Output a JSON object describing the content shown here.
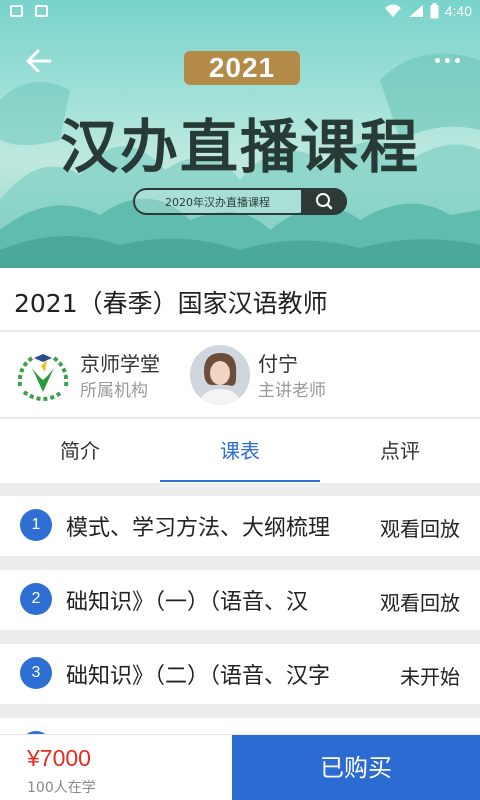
{
  "status_bar": {
    "time": "4:40"
  },
  "banner": {
    "year": "2021",
    "title": "汉办直播课程",
    "search_placeholder": "2020年汉办直播课程"
  },
  "course": {
    "title": "2021（春季）国家汉语教师"
  },
  "institution": {
    "name": "京师学堂",
    "role": "所属机构"
  },
  "teacher": {
    "name": "付宁",
    "role": "主讲老师"
  },
  "tabs": [
    {
      "label": "简介",
      "active": false
    },
    {
      "label": "课表",
      "active": true
    },
    {
      "label": "点评",
      "active": false
    }
  ],
  "lessons": [
    {
      "num": "1",
      "title": "模式、学习方法、大纲梳理",
      "status": "观看回放"
    },
    {
      "num": "2",
      "title": "础知识》（一）（语音、汉",
      "status": "观看回放"
    },
    {
      "num": "3",
      "title": "础知识》（二）（语音、汉字",
      "status": "未开始"
    }
  ],
  "footer": {
    "price": "¥7000",
    "learners": "100人在学",
    "action": "已购买"
  },
  "colors": {
    "accent": "#2f6fd3",
    "price": "#e52b23",
    "banner_badge": "#b38a48"
  },
  "icons": [
    "back-arrow-icon",
    "more-icon",
    "search-icon",
    "wifi-icon",
    "battery-icon",
    "image-icon",
    "font-icon"
  ]
}
